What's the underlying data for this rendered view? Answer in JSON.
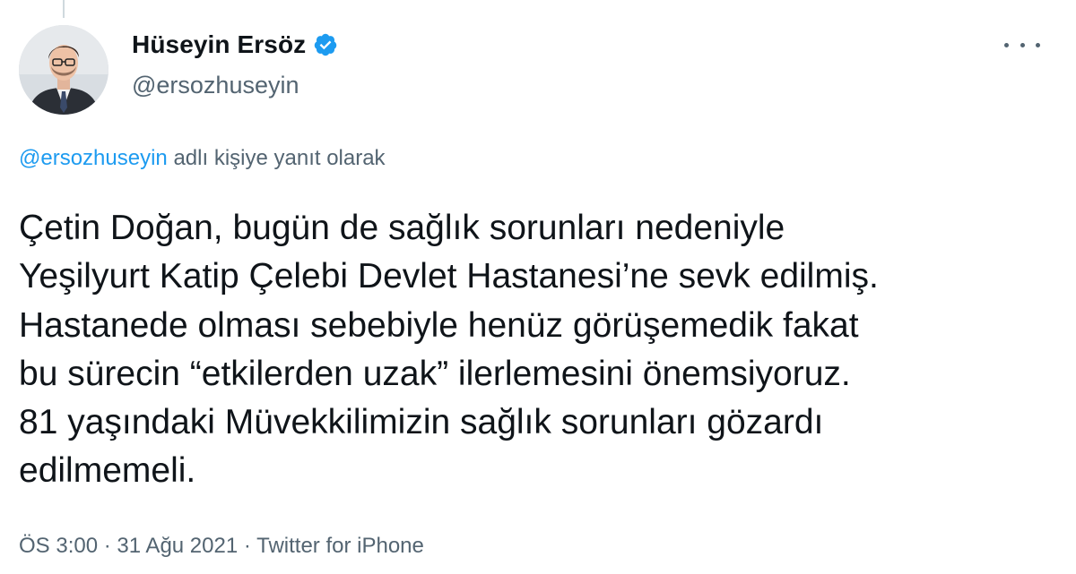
{
  "tweet": {
    "author": {
      "display_name": "Hüseyin Ersöz",
      "handle": "@ersozhuseyin",
      "verified_icon": "verified-badge-icon",
      "avatar_icon": "avatar-photo"
    },
    "more_icon": "more-options-icon",
    "reply_to": {
      "mention": "@ersozhuseyin",
      "text": " adlı kişiye yanıt olarak"
    },
    "body_lines": [
      "Çetin Doğan, bugün de sağlık sorunları nedeniyle",
      "Yeşilyurt Katip Çelebi Devlet Hastanesi’ne sevk edilmiş.",
      "Hastanede olması sebebiyle henüz görüşemedik fakat",
      "bu sürecin “etkilerden uzak” ilerlemesini önemsiyoruz.",
      "81 yaşındaki Müvekkilimizin sağlık sorunları gözardı",
      "edilmemeli."
    ],
    "meta": {
      "time": "ÖS 3:00",
      "separator": " · ",
      "date": "31 Ağu 2021",
      "source": "Twitter for iPhone"
    }
  },
  "colors": {
    "text": "#0f1419",
    "secondary": "#536471",
    "link": "#1d9bf0",
    "thread_line": "#cfd9de"
  }
}
